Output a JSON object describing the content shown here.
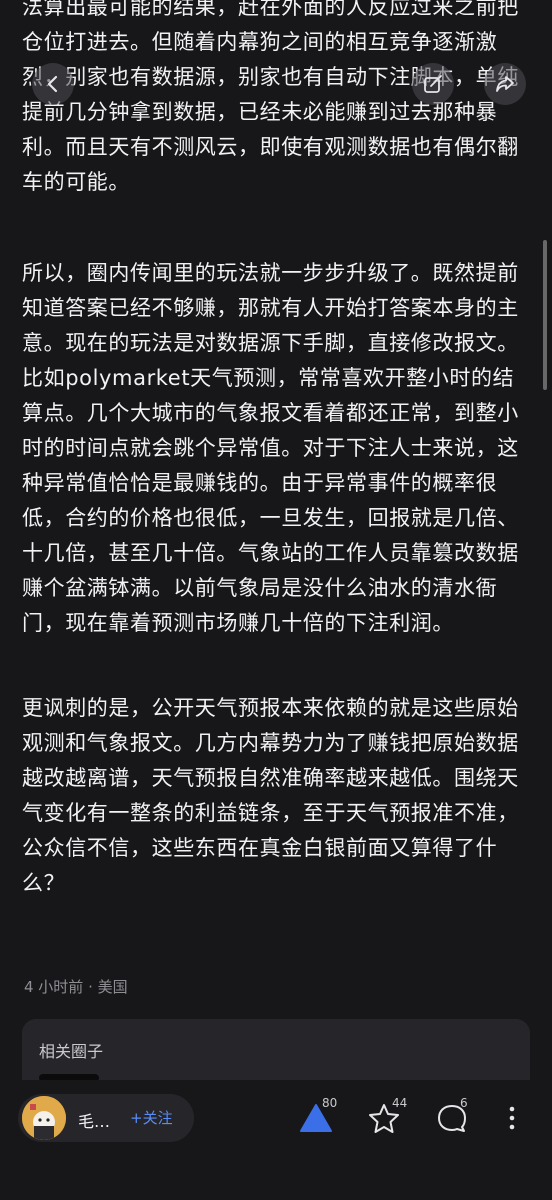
{
  "article": {
    "paragraphs": [
      "法算出最可能的结果，赶在外面的人反应过来之前把仓位打进去。但随着内幕狗之间的相互竞争逐渐激烈，别家也有数据源，别家也有自动下注脚本，单纯提前几分钟拿到数据，已经未必能赚到过去那种暴利。而且天有不测风云，即使有观测数据也有偶尔翻车的可能。",
      "所以，圈内传闻里的玩法就一步步升级了。既然提前知道答案已经不够赚，那就有人开始打答案本身的主意。现在的玩法是对数据源下手脚，直接修改报文。比如polymarket天气预测，常常喜欢开整小时的结算点。几个大城市的气象报文看着都还正常，到整小时的时间点就会跳个异常值。对于下注人士来说，这种异常值恰恰是最赚钱的。由于异常事件的概率很低，合约的价格也很低，一旦发生，回报就是几倍、十几倍，甚至几十倍。气象站的工作人员靠篡改数据赚个盆满钵满。以前气象局是没什么油水的清水衙门，现在靠着预测市场赚几十倍的下注利润。",
      "更讽刺的是，公开天气预报本来依赖的就是这些原始观测和气象报文。几方内幕势力为了赚钱把原始数据越改越离谱，天气预报自然准确率越来越低。围绕天气变化有一整条的利益链条，至于天气预报准不准，公众信不信，这些东西在真金白银前面又算得了什么？"
    ],
    "meta": "4 小时前 · 美国"
  },
  "circle": {
    "title": "相关圈子"
  },
  "bottom_bar": {
    "author_name": "毛…",
    "follow_label": "+关注",
    "like_count": "80",
    "favorite_count": "44",
    "comment_count": "6"
  },
  "colors": {
    "background": "#17171a",
    "accent": "#5b8cf5",
    "like_active": "#3b6fe8"
  },
  "icons": [
    "back-icon",
    "edit-icon",
    "share-icon",
    "like-triangle-icon",
    "star-icon",
    "comment-icon",
    "more-icon"
  ]
}
